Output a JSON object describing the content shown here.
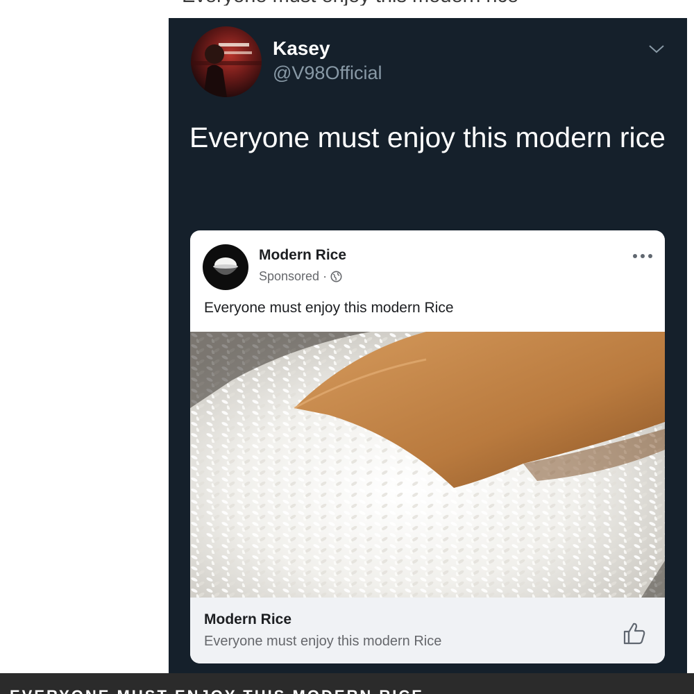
{
  "top_caption": "Everyone must enjoy this modern rice",
  "tweet": {
    "author_name": "Kasey",
    "author_handle": "@V98Official",
    "text": "Everyone must enjoy this modern rice",
    "colors": {
      "background": "#15202b",
      "handle": "#8899a6"
    }
  },
  "ad": {
    "page_name": "Modern Rice",
    "sponsored_label": "Sponsored",
    "separator": "·",
    "post_text": "Everyone must enjoy this modern Rice",
    "link_title": "Modern Rice",
    "link_description": "Everyone must enjoy this modern Rice",
    "icons": [
      "more-options-icon",
      "globe-icon",
      "like-icon"
    ]
  },
  "bottom_caption": "EVERYONE MUST ENJOY THIS MODERN RICE"
}
